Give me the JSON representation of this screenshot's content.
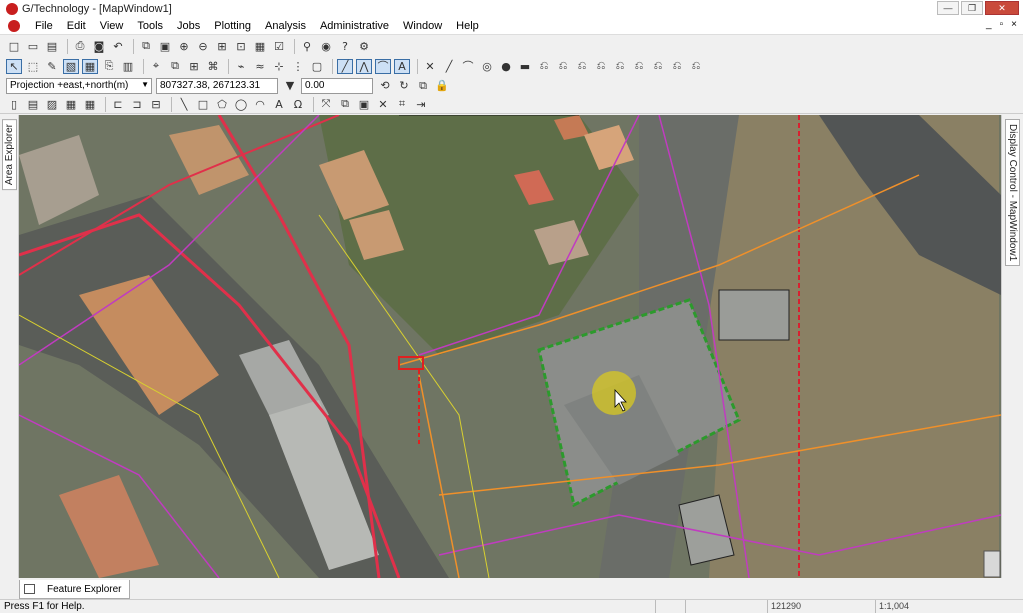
{
  "window": {
    "title": "G/Technology - [MapWindow1]",
    "min_label": "—",
    "max_label": "❐",
    "close_label": "✕"
  },
  "menu": {
    "items": [
      "File",
      "Edit",
      "View",
      "Tools",
      "Jobs",
      "Plotting",
      "Analysis",
      "Administrative",
      "Window",
      "Help"
    ],
    "mdi": [
      "_",
      "▫",
      "×"
    ]
  },
  "coords": {
    "projection": "Projection +east,+north(m)",
    "position": "807327.38, 267123.31",
    "angle": "0.00"
  },
  "panels": {
    "left_tab": "Area Explorer",
    "right_tab": "Display Control - MapWindow1",
    "bottom_tab": "Feature Explorer"
  },
  "status": {
    "help_text": "Press F1 for Help.",
    "cell1": "",
    "cell2": "",
    "cell3": "121290",
    "scale": "1:1,004"
  },
  "icons": {
    "tb1": [
      "new-icon",
      "open-icon",
      "save-icon",
      "print-icon",
      "camera-icon",
      "undo-icon",
      "copy-icon",
      "paste-icon",
      "zoom-in-icon",
      "zoom-out-icon",
      "zoom-window-icon",
      "fit-icon",
      "pan-icon",
      "select-icon",
      "search-icon",
      "help-icon",
      "tool-icon"
    ],
    "tb2": [
      "select-arrow-icon",
      "select-fence-icon",
      "edit-icon",
      "layer-icon",
      "grid-icon",
      "attach-icon",
      "db-icon",
      "locate-icon",
      "snap-icon",
      "line-icon",
      "angle-icon",
      "text-icon",
      "cross-icon",
      "arc-icon",
      "dot-icon",
      "fill-dot-icon",
      "bars-icon",
      "symbol-icon"
    ],
    "tb3": [
      "rotate-icon",
      "redo-icon",
      "window-icon",
      "lock-icon"
    ],
    "tb4": [
      "page-icon",
      "save-icon",
      "delete-icon",
      "table-icon",
      "table-icon",
      "line-draw-icon",
      "rect-icon",
      "poly-icon",
      "ellipse-icon",
      "arc-draw-icon",
      "text-a-icon",
      "omega-icon",
      "break-icon",
      "copy-draw-icon",
      "move-icon",
      "align-icon",
      "dim-icon"
    ]
  }
}
